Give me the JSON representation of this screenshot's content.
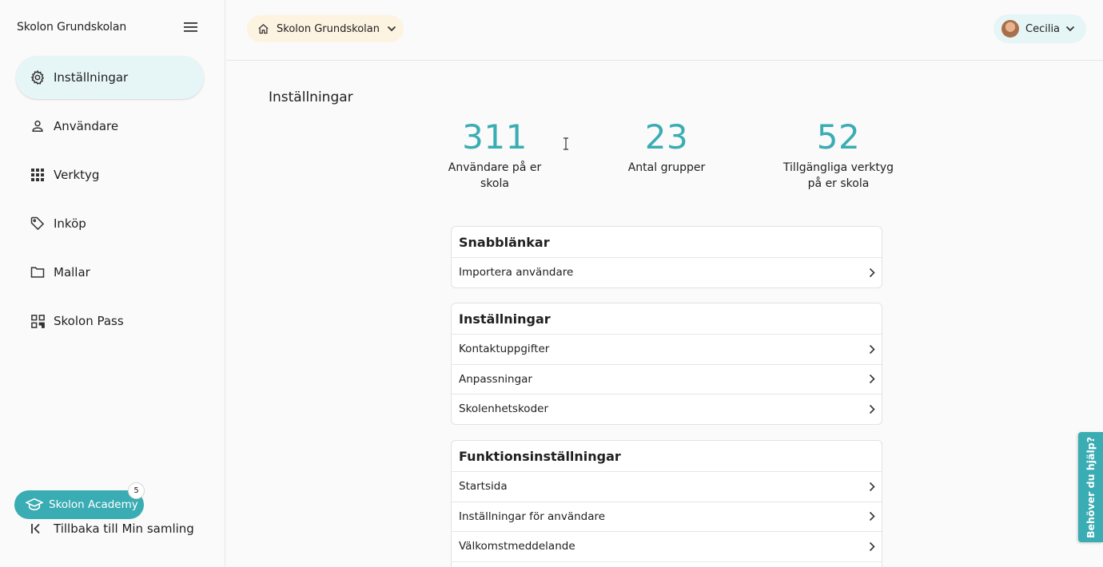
{
  "sidebar": {
    "title": "Skolon Grundskolan",
    "items": [
      {
        "label": "Inställningar",
        "icon": "gear-icon",
        "active": true
      },
      {
        "label": "Användare",
        "icon": "person-icon"
      },
      {
        "label": "Verktyg",
        "icon": "grid-icon"
      },
      {
        "label": "Inköp",
        "icon": "tag-icon"
      },
      {
        "label": "Mallar",
        "icon": "folder-icon"
      },
      {
        "label": "Skolon Pass",
        "icon": "qr-code-icon"
      }
    ],
    "academy_label": "Skolon Academy",
    "academy_badge": "5",
    "back_label": "Tillbaka till Min samling"
  },
  "topbar": {
    "school_name": "Skolon Grundskolan",
    "user_name": "Cecilia"
  },
  "main": {
    "title": "Inställningar",
    "stats": [
      {
        "value": "311",
        "label_line1": "Användare på er",
        "label_line2": "skola"
      },
      {
        "value": "23",
        "label_line1": "Antal grupper",
        "label_line2": ""
      },
      {
        "value": "52",
        "label_line1": "Tillgängliga verktyg",
        "label_line2": "på er skola"
      }
    ],
    "sections": [
      {
        "title": "Snabblänkar",
        "rows": [
          "Importera användare"
        ]
      },
      {
        "title": "Inställningar",
        "rows": [
          "Kontaktuppgifter",
          "Anpassningar",
          "Skolenhetskoder"
        ]
      },
      {
        "title": "Funktionsinställningar",
        "rows": [
          "Startsida",
          "Inställningar för användare",
          "Välkomstmeddelande"
        ]
      }
    ]
  },
  "help_tab_label": "Behöver du hjälp?",
  "colors": {
    "accent": "#3aacb3",
    "active_bg": "#e6f5f6",
    "school_select_bg": "#fdf3e1"
  }
}
